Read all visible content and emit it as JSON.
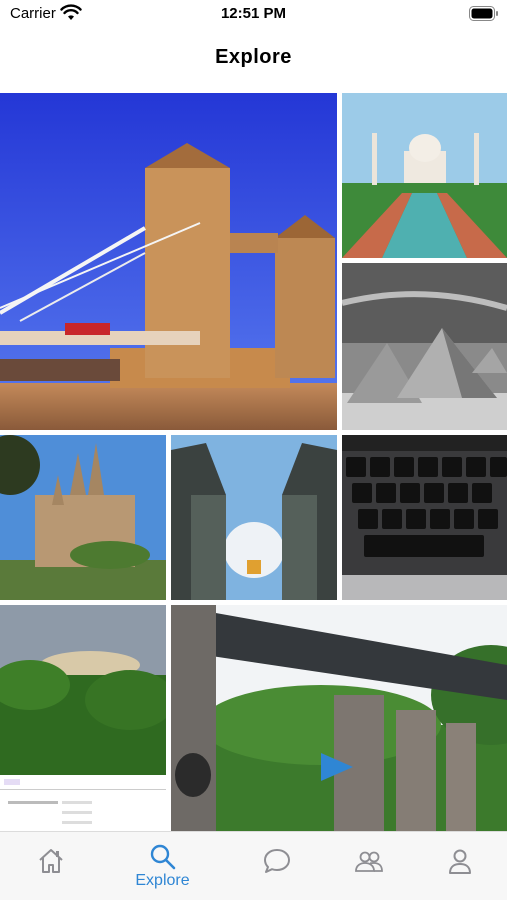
{
  "status_bar": {
    "carrier": "Carrier",
    "time": "12:51 PM"
  },
  "nav": {
    "title": "Explore"
  },
  "grid": {
    "tiles": [
      {
        "name": "tower-bridge-photo"
      },
      {
        "name": "taj-mahal-photo"
      },
      {
        "name": "pyramids-photo"
      },
      {
        "name": "sagrada-familia-photo"
      },
      {
        "name": "bali-gate-photo"
      },
      {
        "name": "laptop-keyboard-photo"
      },
      {
        "name": "forest-clouds-photo"
      },
      {
        "name": "railway-bridge-video"
      }
    ]
  },
  "tab_bar": {
    "active_color": "#2f86d4",
    "inactive_color": "#8e8e93",
    "tabs": [
      {
        "icon": "home-icon",
        "label": ""
      },
      {
        "icon": "search-icon",
        "label": "Explore",
        "active": true
      },
      {
        "icon": "chat-bubble-icon",
        "label": ""
      },
      {
        "icon": "people-icon",
        "label": ""
      },
      {
        "icon": "person-icon",
        "label": ""
      }
    ]
  }
}
